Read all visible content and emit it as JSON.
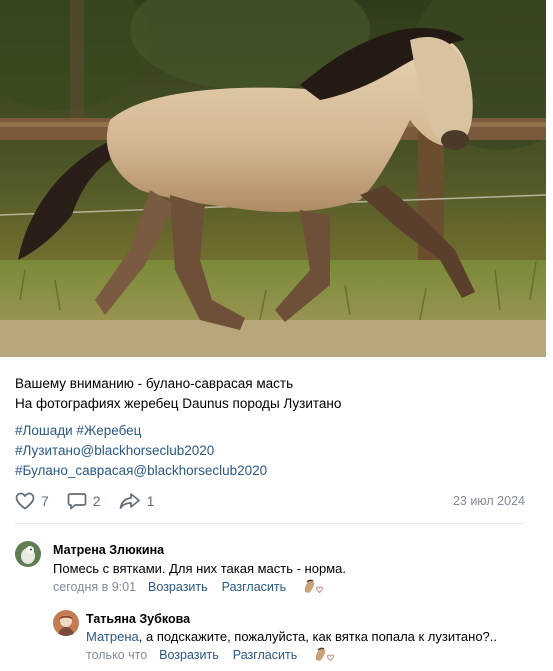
{
  "post": {
    "line1": "Вашему вниманию - булано-саврасая масть",
    "line2": "На фотографиях жеребец Daunus породы Лузитано",
    "tags": [
      "#Лошади #Жеребец",
      "#Лузитано@blackhorseclub2020",
      "#Булано_саврасая@blackhorseclub2020"
    ],
    "likes": "7",
    "comments": "2",
    "shares": "1",
    "date": "23 июл 2024"
  },
  "comments": [
    {
      "author": "Матрена Злюкина",
      "text": "Помесь с вятками. Для них такая масть - норма.",
      "time": "сегодня в 9:01",
      "reply": "Возразить",
      "disagree": "Разгласить"
    },
    {
      "author": "Татьяна Зубкова",
      "mention": "Матрена",
      "text": ", а подскажите, пожалуйста, как вятка попала к лузитано?..",
      "time": "только что",
      "reply": "Возразить",
      "disagree": "Разгласить"
    }
  ],
  "colors": {
    "link": "#2a5885",
    "muted": "#818c99",
    "icon": "#626d7a"
  },
  "icons": {
    "like": "heart-icon",
    "comment": "comment-icon",
    "share": "share-icon"
  }
}
